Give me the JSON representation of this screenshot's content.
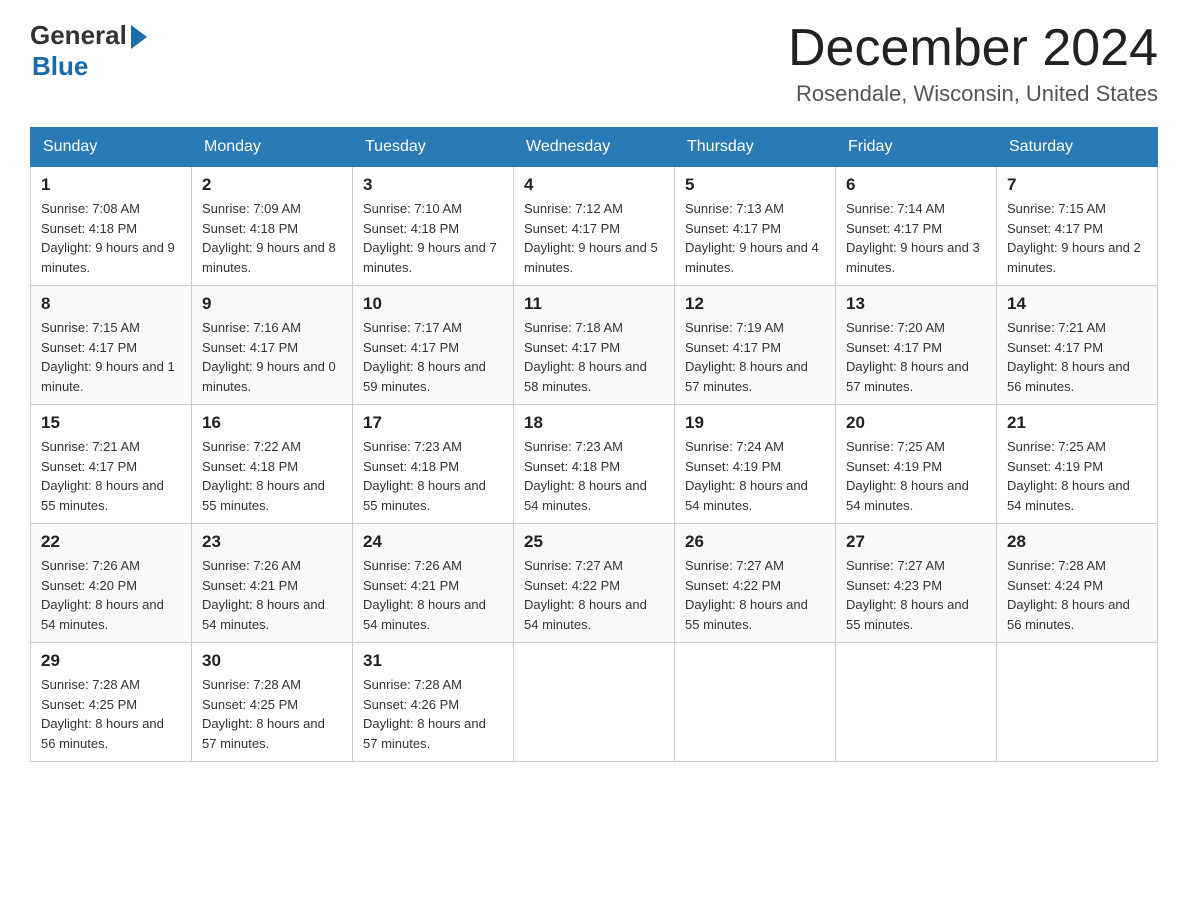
{
  "logo": {
    "general": "General",
    "blue": "Blue"
  },
  "header": {
    "month_year": "December 2024",
    "location": "Rosendale, Wisconsin, United States"
  },
  "days_of_week": [
    "Sunday",
    "Monday",
    "Tuesday",
    "Wednesday",
    "Thursday",
    "Friday",
    "Saturday"
  ],
  "weeks": [
    [
      {
        "day": "1",
        "sunrise": "7:08 AM",
        "sunset": "4:18 PM",
        "daylight": "9 hours and 9 minutes."
      },
      {
        "day": "2",
        "sunrise": "7:09 AM",
        "sunset": "4:18 PM",
        "daylight": "9 hours and 8 minutes."
      },
      {
        "day": "3",
        "sunrise": "7:10 AM",
        "sunset": "4:18 PM",
        "daylight": "9 hours and 7 minutes."
      },
      {
        "day": "4",
        "sunrise": "7:12 AM",
        "sunset": "4:17 PM",
        "daylight": "9 hours and 5 minutes."
      },
      {
        "day": "5",
        "sunrise": "7:13 AM",
        "sunset": "4:17 PM",
        "daylight": "9 hours and 4 minutes."
      },
      {
        "day": "6",
        "sunrise": "7:14 AM",
        "sunset": "4:17 PM",
        "daylight": "9 hours and 3 minutes."
      },
      {
        "day": "7",
        "sunrise": "7:15 AM",
        "sunset": "4:17 PM",
        "daylight": "9 hours and 2 minutes."
      }
    ],
    [
      {
        "day": "8",
        "sunrise": "7:15 AM",
        "sunset": "4:17 PM",
        "daylight": "9 hours and 1 minute."
      },
      {
        "day": "9",
        "sunrise": "7:16 AM",
        "sunset": "4:17 PM",
        "daylight": "9 hours and 0 minutes."
      },
      {
        "day": "10",
        "sunrise": "7:17 AM",
        "sunset": "4:17 PM",
        "daylight": "8 hours and 59 minutes."
      },
      {
        "day": "11",
        "sunrise": "7:18 AM",
        "sunset": "4:17 PM",
        "daylight": "8 hours and 58 minutes."
      },
      {
        "day": "12",
        "sunrise": "7:19 AM",
        "sunset": "4:17 PM",
        "daylight": "8 hours and 57 minutes."
      },
      {
        "day": "13",
        "sunrise": "7:20 AM",
        "sunset": "4:17 PM",
        "daylight": "8 hours and 57 minutes."
      },
      {
        "day": "14",
        "sunrise": "7:21 AM",
        "sunset": "4:17 PM",
        "daylight": "8 hours and 56 minutes."
      }
    ],
    [
      {
        "day": "15",
        "sunrise": "7:21 AM",
        "sunset": "4:17 PM",
        "daylight": "8 hours and 55 minutes."
      },
      {
        "day": "16",
        "sunrise": "7:22 AM",
        "sunset": "4:18 PM",
        "daylight": "8 hours and 55 minutes."
      },
      {
        "day": "17",
        "sunrise": "7:23 AM",
        "sunset": "4:18 PM",
        "daylight": "8 hours and 55 minutes."
      },
      {
        "day": "18",
        "sunrise": "7:23 AM",
        "sunset": "4:18 PM",
        "daylight": "8 hours and 54 minutes."
      },
      {
        "day": "19",
        "sunrise": "7:24 AM",
        "sunset": "4:19 PM",
        "daylight": "8 hours and 54 minutes."
      },
      {
        "day": "20",
        "sunrise": "7:25 AM",
        "sunset": "4:19 PM",
        "daylight": "8 hours and 54 minutes."
      },
      {
        "day": "21",
        "sunrise": "7:25 AM",
        "sunset": "4:19 PM",
        "daylight": "8 hours and 54 minutes."
      }
    ],
    [
      {
        "day": "22",
        "sunrise": "7:26 AM",
        "sunset": "4:20 PM",
        "daylight": "8 hours and 54 minutes."
      },
      {
        "day": "23",
        "sunrise": "7:26 AM",
        "sunset": "4:21 PM",
        "daylight": "8 hours and 54 minutes."
      },
      {
        "day": "24",
        "sunrise": "7:26 AM",
        "sunset": "4:21 PM",
        "daylight": "8 hours and 54 minutes."
      },
      {
        "day": "25",
        "sunrise": "7:27 AM",
        "sunset": "4:22 PM",
        "daylight": "8 hours and 54 minutes."
      },
      {
        "day": "26",
        "sunrise": "7:27 AM",
        "sunset": "4:22 PM",
        "daylight": "8 hours and 55 minutes."
      },
      {
        "day": "27",
        "sunrise": "7:27 AM",
        "sunset": "4:23 PM",
        "daylight": "8 hours and 55 minutes."
      },
      {
        "day": "28",
        "sunrise": "7:28 AM",
        "sunset": "4:24 PM",
        "daylight": "8 hours and 56 minutes."
      }
    ],
    [
      {
        "day": "29",
        "sunrise": "7:28 AM",
        "sunset": "4:25 PM",
        "daylight": "8 hours and 56 minutes."
      },
      {
        "day": "30",
        "sunrise": "7:28 AM",
        "sunset": "4:25 PM",
        "daylight": "8 hours and 57 minutes."
      },
      {
        "day": "31",
        "sunrise": "7:28 AM",
        "sunset": "4:26 PM",
        "daylight": "8 hours and 57 minutes."
      },
      null,
      null,
      null,
      null
    ]
  ]
}
